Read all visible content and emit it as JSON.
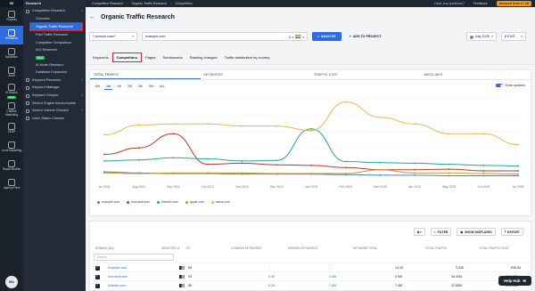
{
  "topbar": {
    "crumbs": [
      "Competitive Research",
      "Organic Traffic Research",
      "Competitors"
    ],
    "help": "Have any questions?",
    "feedback": "Feedback",
    "account": "Account from 4 / 18"
  },
  "rail": {
    "logo": "SE Ranking",
    "items": [
      {
        "label": "Projects"
      },
      {
        "label": "Research",
        "active": true
      },
      {
        "label": "Backlinks"
      },
      {
        "label": "Audit"
      },
      {
        "label": "AI Search",
        "badge": "New"
      },
      {
        "label": "Content Marketing"
      },
      {
        "label": "SERP"
      },
      {
        "label": "Local Marketing"
      },
      {
        "label": "Report Builder"
      },
      {
        "label": "Agency Pack"
      }
    ],
    "avatar": "MA"
  },
  "sidebar": {
    "header": "Research",
    "group1": "Competitive Research",
    "group1_items": [
      "Overview",
      "Organic Traffic Research",
      "Paid Traffic Research",
      "Competitor Comparison",
      "AIO Research",
      "AI Mode Research"
    ],
    "aio_badge": "New",
    "database": "Database Expansion",
    "groups": [
      "Keyword Research",
      "Keyword Manager",
      "Keyword Grouper",
      "Search Engine Autocomplete",
      "Search Volume Checker",
      "Index Status Checker"
    ]
  },
  "header": {
    "title": "Organic Traffic Research"
  },
  "search": {
    "mode": "*.domain.com/*",
    "domain": "example.com",
    "engine": "G",
    "analyze": "ANALYZE",
    "add_project": "ADD TO PROJECT",
    "date": "July 2025",
    "currency": "€ EUR"
  },
  "tabs": [
    "Keywords",
    "Competitors",
    "Pages",
    "Subdomains",
    "Ranking changes",
    "Traffic distribution by country"
  ],
  "metric_tabs": [
    "TOTAL TRAFFIC",
    "KEYWORDS",
    "TRAFFIC COST",
    "BACKLINKS"
  ],
  "ranges": [
    "6M",
    "1M",
    "1M",
    "2M",
    "3M",
    "5M",
    "ALL"
  ],
  "show_updates": "Show updates",
  "chart_data": {
    "type": "line",
    "x": [
      "Jul 2024",
      "Aug 2024",
      "Sep 2024",
      "Oct 2024",
      "Nov 2024",
      "Dec 2024",
      "Jan 2025",
      "Feb 2025",
      "Mar 2025",
      "Apr 2025",
      "May 2025",
      "Jun 2025",
      "Jul 2025"
    ],
    "series": [
      {
        "name": "example.com",
        "color": "#4f7bd8",
        "values": [
          0.16,
          0.14,
          0.13,
          0.13,
          0.12,
          0.12,
          0.12,
          0.11,
          0.1,
          0.1,
          0.09,
          0.09,
          0.09
        ]
      },
      {
        "name": "microsoft.com",
        "color": "#c0392b",
        "values": [
          0.48,
          0.6,
          0.86,
          0.3,
          0.32,
          0.29,
          0.28,
          0.24,
          0.2,
          0.2,
          0.21,
          0.18,
          0.18
        ]
      },
      {
        "name": "linkedin.com",
        "color": "#26a69a",
        "values": [
          0.36,
          0.38,
          0.42,
          0.4,
          0.36,
          0.37,
          0.95,
          0.35,
          0.33,
          0.32,
          0.3,
          0.28,
          0.27
        ]
      },
      {
        "name": "apple.com",
        "color": "#c49a1f",
        "values": [
          0.14,
          0.13,
          0.14,
          0.14,
          0.14,
          0.13,
          0.13,
          0.13,
          0.2,
          0.14,
          0.14,
          0.13,
          0.12
        ]
      },
      {
        "name": "canva.com",
        "color": "#e6b84a",
        "values": [
          0.84,
          1.02,
          1.04,
          1.04,
          1.0,
          1.0,
          0.92,
          1.44,
          1.16,
          1.04,
          0.86,
          0.86,
          0.66
        ]
      }
    ]
  },
  "table": {
    "toolbar": [
      "FILTER",
      "SHOW DISPLAYED",
      "EXPORT"
    ],
    "columns": [
      "DOMAIN (281)",
      "SELECTED: 5",
      "ST",
      "COMMON KEYWORDS",
      "MISSING KEYWORDS",
      "KEYWORD TOTAL",
      "TOTAL TRAFFIC",
      "TOTAL TRAFFIC COST"
    ],
    "search_placeholder": "Search",
    "rows": [
      {
        "domain": "example.com",
        "st": "65",
        "common": "-",
        "missing": "-",
        "kw_total": "14.2K",
        "traffic": "3.02K",
        "cost": "€36.59"
      },
      {
        "domain": "microsoft.com",
        "st": "93",
        "common": "5.3K",
        "missing": "2.9M",
        "kw_total": "2.9M",
        "traffic": "16.32M",
        "cost": "€26.57M"
      },
      {
        "domain": "linkedin.com",
        "st": "98",
        "common": "5.2K",
        "missing": "7.6M",
        "kw_total": "7.4M",
        "traffic": "22.80M",
        "cost": "€14.91M"
      }
    ]
  },
  "help_hub": "Help Hub"
}
